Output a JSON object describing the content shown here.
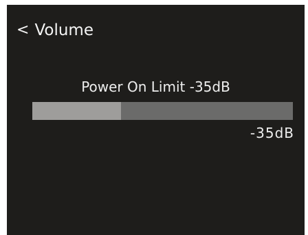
{
  "header": {
    "back_symbol": "<",
    "title": "Volume"
  },
  "setting": {
    "title": "Power On Limit -35dB",
    "value_label": "-35dB",
    "level_fraction": 0.34
  },
  "colors": {
    "screen_background": "#1e1d1b",
    "track": "#6b6b6a",
    "fill": "#9e9d9b",
    "text": "#eeeeee"
  }
}
